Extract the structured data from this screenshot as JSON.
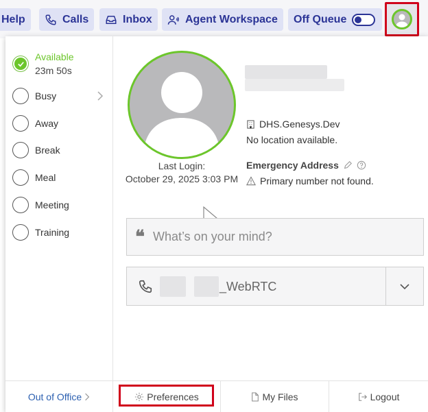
{
  "nav": {
    "help": "Help",
    "calls": "Calls",
    "inbox": "Inbox",
    "agent_workspace": "Agent Workspace",
    "off_queue": "Off Queue"
  },
  "status": {
    "available": "Available",
    "available_time": "23m 50s",
    "items": [
      "Busy",
      "Away",
      "Break",
      "Meal",
      "Meeting",
      "Training"
    ]
  },
  "profile": {
    "last_login_label": "Last Login:",
    "last_login_value": "October 29, 2025 3:03 PM",
    "org": "DHS.Genesys.Dev",
    "location": "No location available.",
    "emergency_title": "Emergency Address",
    "emergency_msg": "Primary number not found."
  },
  "post": {
    "placeholder": "What’s on your mind?"
  },
  "phone": {
    "label": "_WebRTC"
  },
  "footer": {
    "out_of_office": "Out of Office",
    "preferences": "Preferences",
    "my_files": "My Files",
    "logout": "Logout"
  },
  "colors": {
    "accent": "#2b3496",
    "available": "#6cc62b",
    "highlight": "#d0021b"
  }
}
